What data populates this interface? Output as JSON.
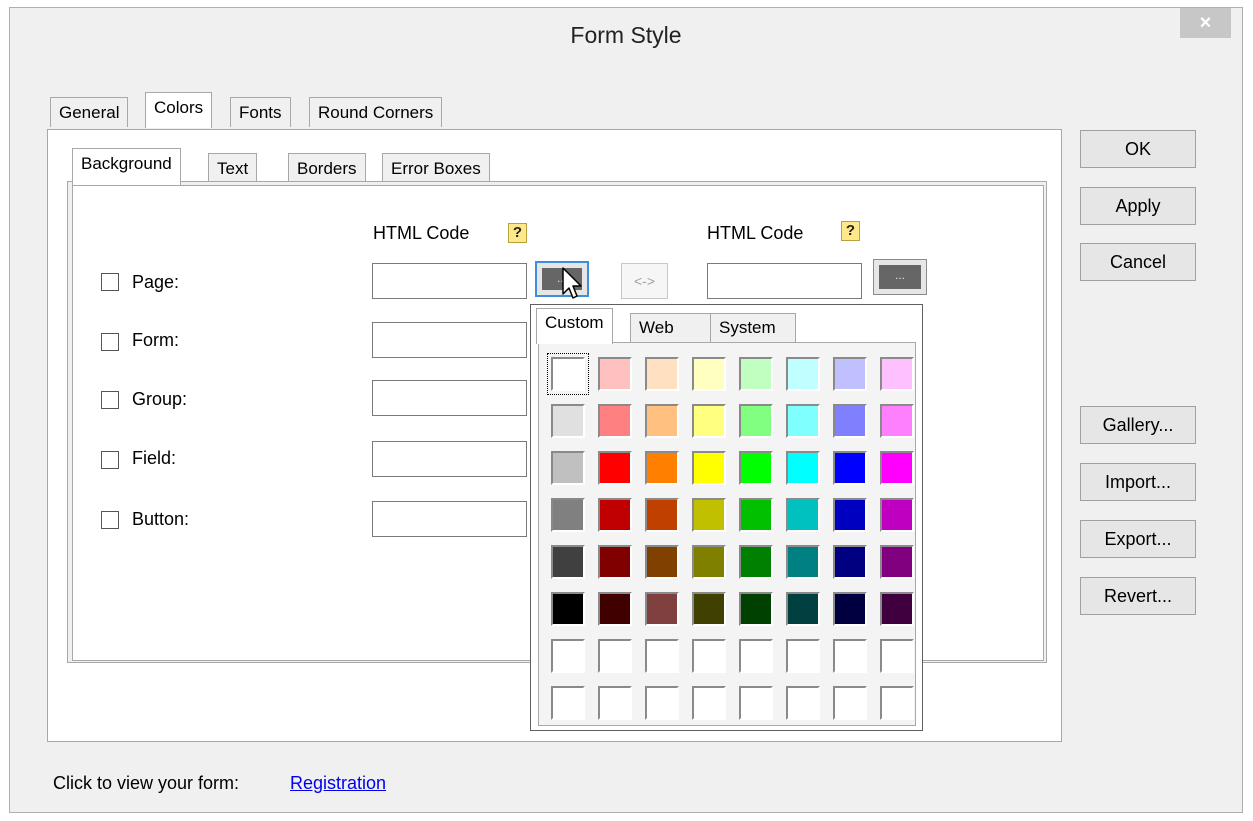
{
  "window": {
    "title": "Form Style",
    "close_label": "×"
  },
  "outer_tabs": [
    {
      "label": "General",
      "active": false
    },
    {
      "label": "Colors",
      "active": true
    },
    {
      "label": "Fonts",
      "active": false
    },
    {
      "label": "Round Corners",
      "active": false
    }
  ],
  "inner_tabs": [
    {
      "label": "Background",
      "active": true
    },
    {
      "label": "Text",
      "active": false
    },
    {
      "label": "Borders",
      "active": false
    },
    {
      "label": "Error Boxes",
      "active": false
    }
  ],
  "columns": {
    "html_code_1": "HTML Code",
    "html_code_2": "HTML Code",
    "help_glyph": "?"
  },
  "rows": [
    {
      "label": "Page:",
      "checked": false,
      "value": ""
    },
    {
      "label": "Form:",
      "checked": false,
      "value": ""
    },
    {
      "label": "Group:",
      "checked": false,
      "value": ""
    },
    {
      "label": "Field:",
      "checked": false,
      "value": ""
    },
    {
      "label": "Button:",
      "checked": false,
      "value": ""
    }
  ],
  "picker_button_label": "...",
  "swap_label": "<->",
  "side_buttons": [
    "OK",
    "Apply",
    "Cancel",
    "Gallery...",
    "Import...",
    "Export...",
    "Revert..."
  ],
  "footer": {
    "text": "Click to view your form:",
    "link": "Registration"
  },
  "color_popup": {
    "tabs": [
      {
        "label": "Custom",
        "active": true
      },
      {
        "label": "Web",
        "active": false
      },
      {
        "label": "System",
        "active": false
      }
    ],
    "palette": [
      [
        "#FFFFFF",
        "#FFC0C0",
        "#FFE0C0",
        "#FFFFC0",
        "#C0FFC0",
        "#C0FFFF",
        "#C0C0FF",
        "#FFC0FF"
      ],
      [
        "#E0E0E0",
        "#FF8080",
        "#FFC080",
        "#FFFF80",
        "#80FF80",
        "#80FFFF",
        "#8080FF",
        "#FF80FF"
      ],
      [
        "#C0C0C0",
        "#FF0000",
        "#FF8000",
        "#FFFF00",
        "#00FF00",
        "#00FFFF",
        "#0000FF",
        "#FF00FF"
      ],
      [
        "#808080",
        "#C00000",
        "#C04000",
        "#C0C000",
        "#00C000",
        "#00C0C0",
        "#0000C0",
        "#C000C0"
      ],
      [
        "#404040",
        "#800000",
        "#804000",
        "#808000",
        "#008000",
        "#008080",
        "#000080",
        "#800080"
      ],
      [
        "#000000",
        "#400000",
        "#804040",
        "#404000",
        "#004000",
        "#004040",
        "#000040",
        "#400040"
      ],
      [
        "#FFFFFF",
        "#FFFFFF",
        "#FFFFFF",
        "#FFFFFF",
        "#FFFFFF",
        "#FFFFFF",
        "#FFFFFF",
        "#FFFFFF"
      ],
      [
        "#FFFFFF",
        "#FFFFFF",
        "#FFFFFF",
        "#FFFFFF",
        "#FFFFFF",
        "#FFFFFF",
        "#FFFFFF",
        "#FFFFFF"
      ]
    ]
  }
}
